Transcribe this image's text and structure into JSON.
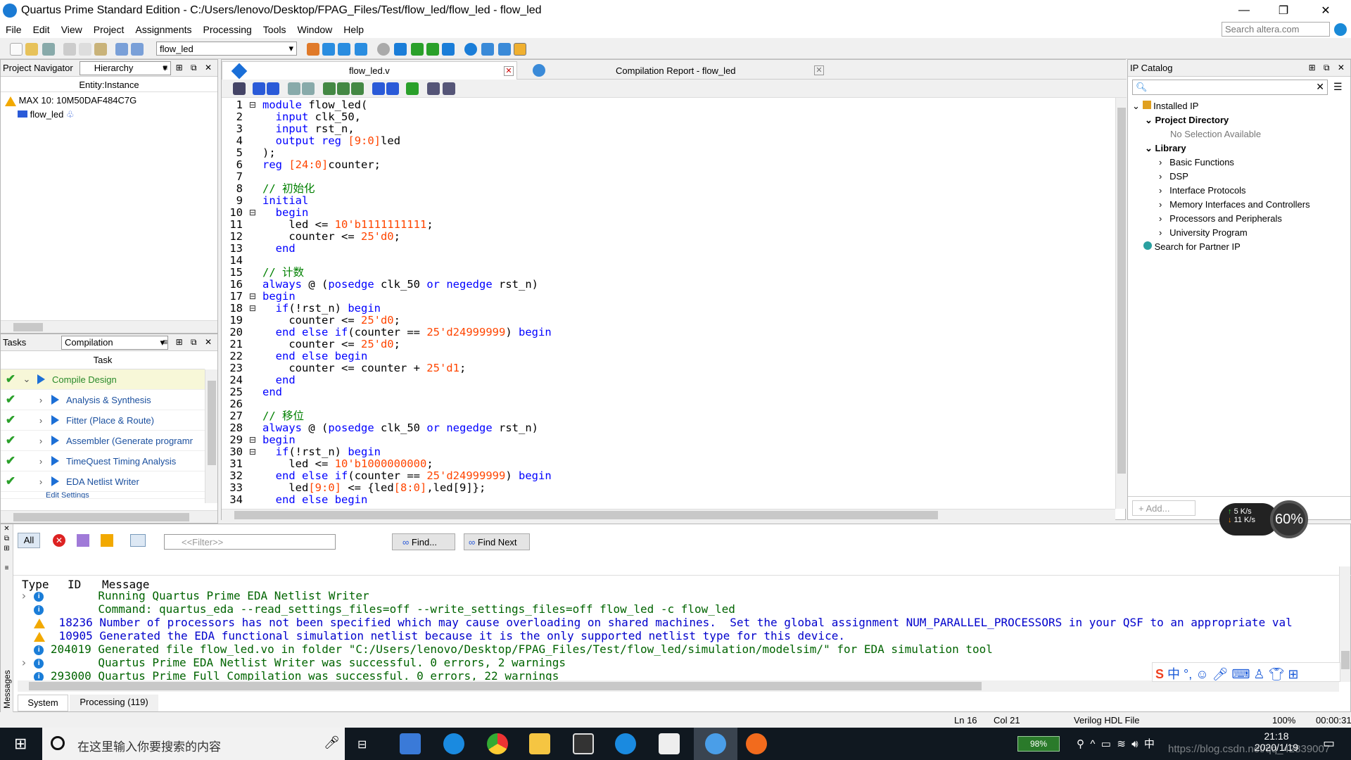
{
  "window": {
    "title": "Quartus Prime Standard Edition - C:/Users/lenovo/Desktop/FPAG_Files/Test/flow_led/flow_led - flow_led"
  },
  "menu": [
    "File",
    "Edit",
    "View",
    "Project",
    "Assignments",
    "Processing",
    "Tools",
    "Window",
    "Help"
  ],
  "search": {
    "placeholder": "Search altera.com"
  },
  "toolbar": {
    "revision": "flow_led"
  },
  "navigator": {
    "title": "Project Navigator",
    "view": "Hierarchy",
    "column": "Entity:Instance",
    "device": "MAX 10: 10M50DAF484C7G",
    "top_entity": "flow_led"
  },
  "tasks": {
    "title": "Tasks",
    "flow": "Compilation",
    "column": "Task",
    "items": [
      "Compile Design",
      "Analysis & Synthesis",
      "Fitter (Place & Route)",
      "Assembler (Generate programming files)",
      "TimeQuest Timing Analysis",
      "EDA Netlist Writer",
      "Edit Settings"
    ]
  },
  "editor": {
    "tabs": [
      "flow_led.v",
      "Compilation Report - flow_led"
    ],
    "lines": [
      "module flow_led(",
      "  input clk_50,",
      "  input rst_n,",
      "  output reg [9:0]led",
      ");",
      "reg [24:0]counter;",
      "",
      "// 初始化",
      "initial",
      "  begin",
      "    led <= 10'b1111111111;",
      "    counter <= 25'd0;",
      "  end",
      "",
      "// 计数",
      "always @ (posedge clk_50 or negedge rst_n)",
      "begin",
      "  if(!rst_n) begin",
      "    counter <= 25'd0;",
      "  end else if(counter == 25'd24999999) begin",
      "    counter <= 25'd0;",
      "  end else begin",
      "    counter <= counter + 25'd1;",
      "  end",
      "end",
      "",
      "// 移位",
      "always @ (posedge clk_50 or negedge rst_n)",
      "begin",
      "  if(!rst_n) begin",
      "    led <= 10'b1000000000;",
      "  end else if(counter == 25'd24999999) begin",
      "    led[9:0] <= {led[8:0],led[9]};",
      "  end else begin"
    ]
  },
  "ip_catalog": {
    "title": "IP Catalog",
    "installed": "Installed IP",
    "project_dir": "Project Directory",
    "no_selection": "No Selection Available",
    "library": "Library",
    "categories": [
      "Basic Functions",
      "DSP",
      "Interface Protocols",
      "Memory Interfaces and Controllers",
      "Processors and Peripherals",
      "University Program"
    ],
    "partner": "Search for Partner IP",
    "add": "Add..."
  },
  "speed": {
    "up": "5",
    "up_unit": "K/s",
    "down": "11",
    "down_unit": "K/s",
    "percent": "60%"
  },
  "messages": {
    "all": "All",
    "filter_placeholder": "<<Filter>>",
    "find": "Find...",
    "find_next": "Find Next",
    "headers": [
      "Type",
      "ID",
      "Message"
    ],
    "rows": [
      {
        "type": "info",
        "id": "",
        "text": "Running Quartus Prime EDA Netlist Writer"
      },
      {
        "type": "info",
        "id": "",
        "text": "Command: quartus_eda --read_settings_files=off --write_settings_files=off flow_led -c flow_led"
      },
      {
        "type": "warn",
        "id": "18236",
        "text": "Number of processors has not been specified which may cause overloading on shared machines.  Set the global assignment NUM_PARALLEL_PROCESSORS in your QSF to an appropriate val"
      },
      {
        "type": "warn",
        "id": "10905",
        "text": "Generated the EDA functional simulation netlist because it is the only supported netlist type for this device."
      },
      {
        "type": "info",
        "id": "204019",
        "text": "Generated file flow_led.vo in folder \"C:/Users/lenovo/Desktop/FPAG_Files/Test/flow_led/simulation/modelsim/\" for EDA simulation tool"
      },
      {
        "type": "info",
        "id": "",
        "text": "Quartus Prime EDA Netlist Writer was successful. 0 errors, 2 warnings"
      },
      {
        "type": "info",
        "id": "293000",
        "text": "Quartus Prime Full Compilation was successful. 0 errors, 22 warnings"
      }
    ],
    "tabs": [
      "System",
      "Processing (119)"
    ],
    "side": "Messages"
  },
  "status": {
    "line": "Ln 16",
    "col": "Col 21",
    "lang": "Verilog HDL File",
    "zoom": "100%",
    "time": "00:00:31"
  },
  "taskbar": {
    "search": "在这里输入你要搜索的内容",
    "battery": "98%",
    "time": "21:18",
    "date": "2020/1/19",
    "watermark": "https://blog.csdn.net/qq_42839007"
  }
}
